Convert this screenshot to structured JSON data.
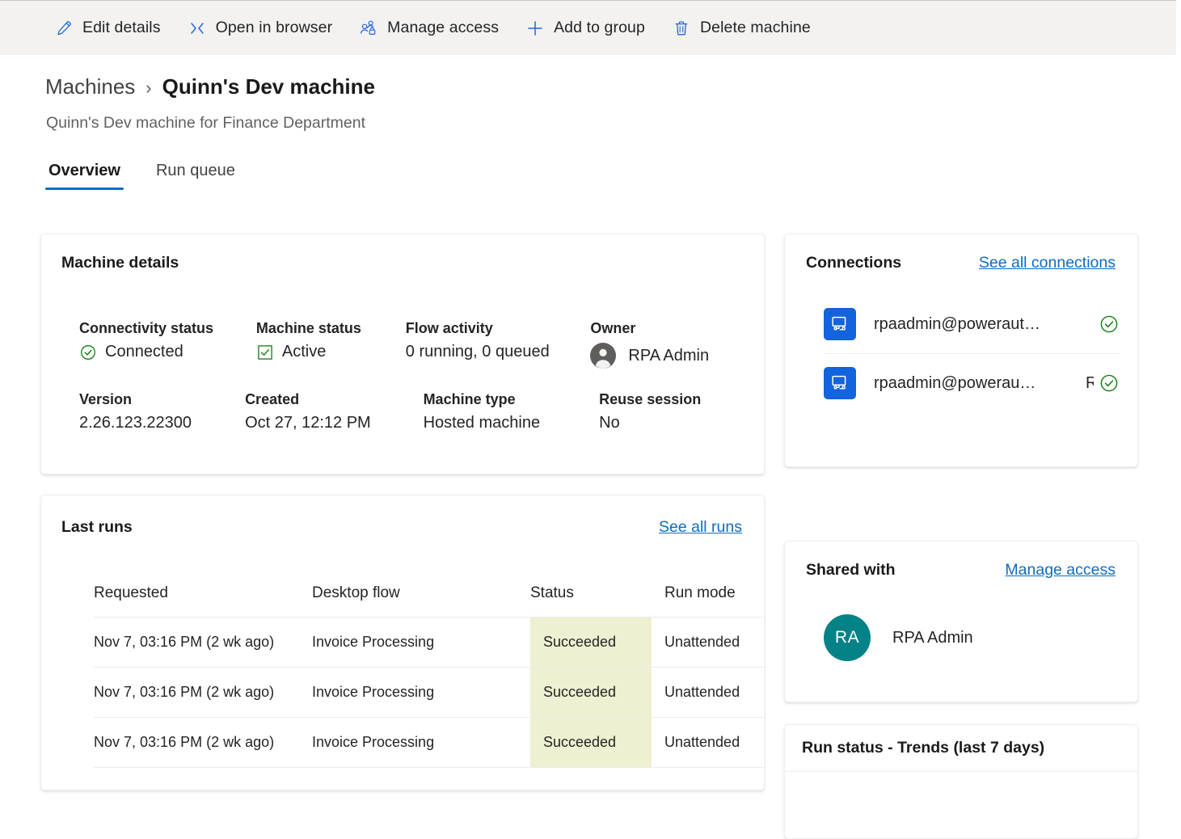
{
  "commandbar": {
    "items": [
      {
        "id": "edit-details",
        "label": "Edit details",
        "icon": "pencil-icon"
      },
      {
        "id": "open-in-browser",
        "label": "Open in browser",
        "icon": "open-in-browser-icon"
      },
      {
        "id": "manage-access",
        "label": "Manage access",
        "icon": "people-lock-icon"
      },
      {
        "id": "add-to-group",
        "label": "Add to group",
        "icon": "plus-icon"
      },
      {
        "id": "delete-machine",
        "label": "Delete machine",
        "icon": "trash-icon"
      }
    ]
  },
  "header": {
    "breadcrumb_parent": "Machines",
    "breadcrumb_separator": "›",
    "title": "Quinn's Dev machine",
    "subtitle": "Quinn's Dev machine for Finance Department"
  },
  "tabs": [
    {
      "id": "overview",
      "label": "Overview",
      "active": true
    },
    {
      "id": "run-queue",
      "label": "Run queue",
      "active": false
    }
  ],
  "machine_details": {
    "title": "Machine details",
    "fields": [
      {
        "label": "Connectivity status",
        "value": "Connected",
        "icon": "circle-check-icon"
      },
      {
        "label": "Machine status",
        "value": "Active",
        "icon": "square-check-icon"
      },
      {
        "label": "Flow activity",
        "value": "0 running, 0 queued",
        "icon": ""
      },
      {
        "label": "Owner",
        "value": "RPA Admin",
        "icon": "person-avatar-icon"
      },
      {
        "label": "Version",
        "value": "2.26.123.22300",
        "icon": ""
      },
      {
        "label": "Created",
        "value": "Oct 27, 12:12 PM",
        "icon": ""
      },
      {
        "label": "Machine type",
        "value": "Hosted machine",
        "icon": ""
      },
      {
        "label": "Reuse session",
        "value": "No",
        "icon": ""
      }
    ]
  },
  "last_runs": {
    "title": "Last runs",
    "see_all_label": "See all runs",
    "columns": [
      "Requested",
      "Desktop flow",
      "Status",
      "Run mode"
    ],
    "rows": [
      {
        "requested": "Nov 7, 03:16 PM (2 wk ago)",
        "flow": "Invoice Processing",
        "status": "Succeeded",
        "run_mode": "Unattended"
      },
      {
        "requested": "Nov 7, 03:16 PM (2 wk ago)",
        "flow": "Invoice Processing",
        "status": "Succeeded",
        "run_mode": "Unattended"
      },
      {
        "requested": "Nov 7, 03:16 PM (2 wk ago)",
        "flow": "Invoice Processing",
        "status": "Succeeded",
        "run_mode": "Unattended"
      }
    ]
  },
  "connections": {
    "title": "Connections",
    "see_all_label": "See all connections",
    "items": [
      {
        "name": "rpaadmin@poweraut…",
        "extra": "",
        "status_icon": "circle-check-icon",
        "icon": "desktop-flow-icon"
      },
      {
        "name": "rpaadmin@powerau…",
        "extra": "R",
        "status_icon": "circle-check-icon",
        "icon": "desktop-flow-icon"
      }
    ]
  },
  "shared_with": {
    "title": "Shared with",
    "manage_access_label": "Manage access",
    "people": [
      {
        "initials": "RA",
        "name": "RPA Admin"
      }
    ]
  },
  "run_trends": {
    "title": "Run status - Trends (last 7 days)"
  },
  "colors": {
    "accent": "#0f6cbd",
    "command_icon": "#2266dd",
    "commandbar_bg": "#f3f2f1",
    "success_green": "#107c10",
    "status_cell_bg": "#eef0d1",
    "avatar_teal": "#038387",
    "connection_blue": "#1263de"
  }
}
